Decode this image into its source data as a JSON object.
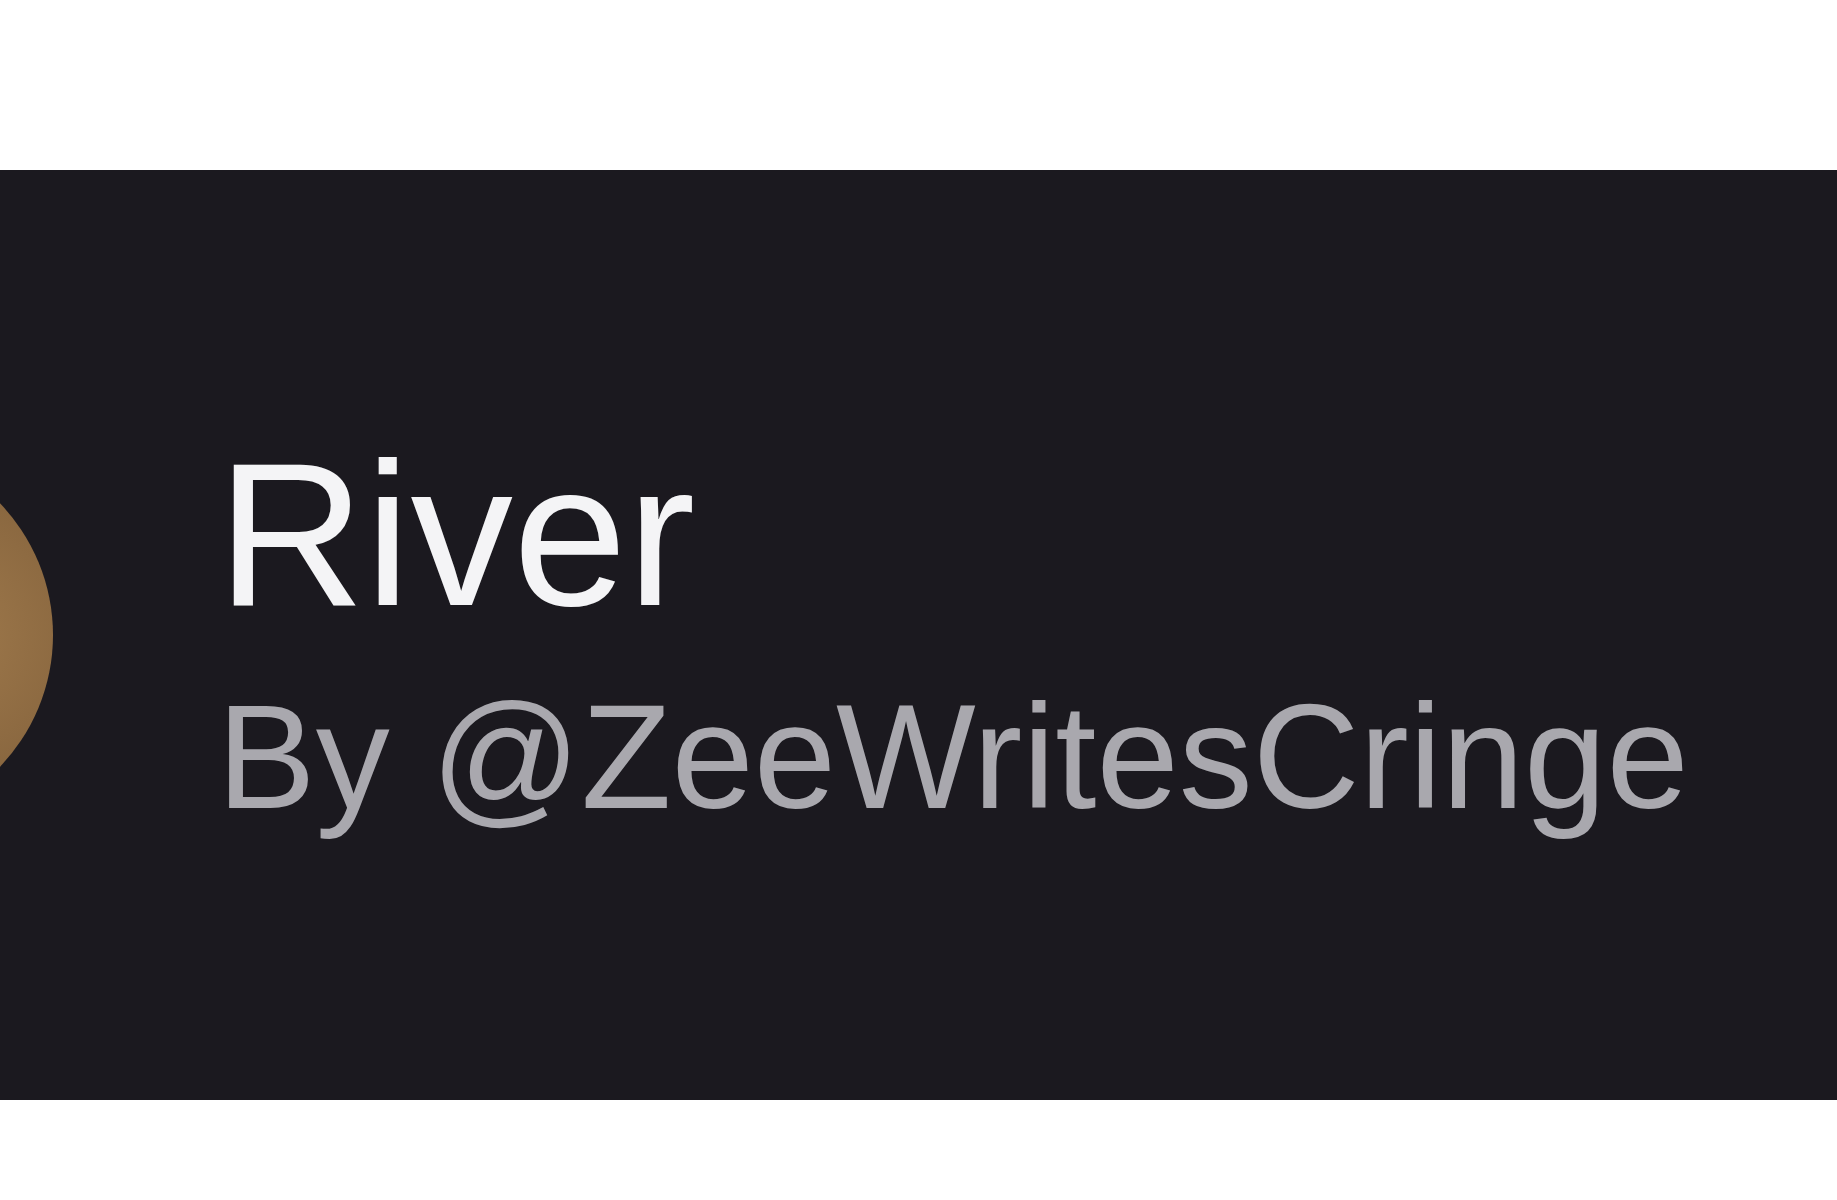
{
  "card": {
    "title": "River",
    "byline": "By @ZeeWritesCringe"
  }
}
